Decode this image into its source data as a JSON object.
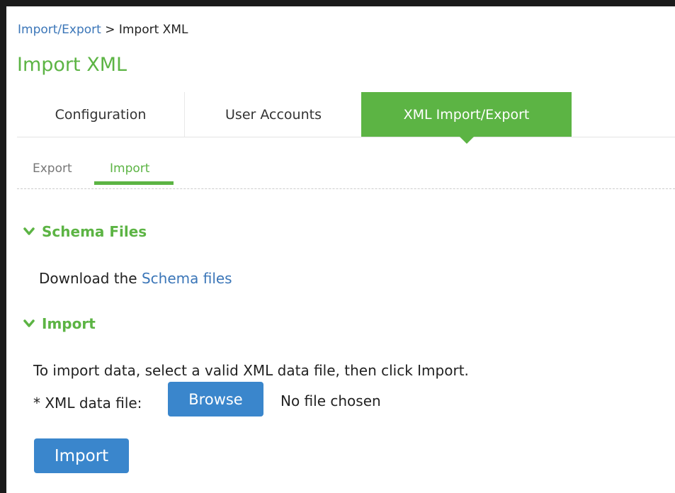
{
  "breadcrumb": {
    "parent": "Import/Export",
    "separator": ">",
    "current": "Import XML"
  },
  "page_title": "Import XML",
  "tabs": [
    {
      "label": "Configuration",
      "active": false
    },
    {
      "label": "User Accounts",
      "active": false
    },
    {
      "label": "XML Import/Export",
      "active": true
    }
  ],
  "subtabs": [
    {
      "label": "Export",
      "active": false
    },
    {
      "label": "Import",
      "active": true
    }
  ],
  "sections": {
    "schema": {
      "icon": "chevron-down-icon",
      "title": "Schema Files",
      "text_prefix": "Download the",
      "link_label": "Schema files"
    },
    "import": {
      "icon": "chevron-down-icon",
      "title": "Import",
      "instructions": "To import data, select a valid XML data file, then click Import.",
      "file_label": "* XML data file:",
      "browse_label": "Browse",
      "file_status": "No file chosen",
      "submit_label": "Import"
    }
  },
  "colors": {
    "accent_green": "#5cb444",
    "link_blue": "#3b76b8",
    "button_blue": "#3a86cc"
  }
}
